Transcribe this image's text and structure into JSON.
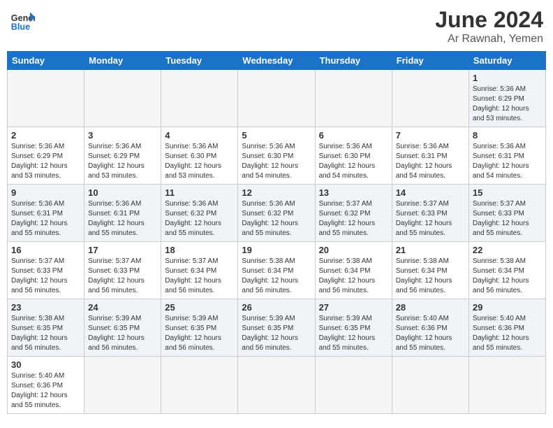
{
  "header": {
    "logo_general": "General",
    "logo_blue": "Blue",
    "title": "June 2024",
    "subtitle": "Ar Rawnah, Yemen"
  },
  "days_of_week": [
    "Sunday",
    "Monday",
    "Tuesday",
    "Wednesday",
    "Thursday",
    "Friday",
    "Saturday"
  ],
  "weeks": [
    [
      null,
      null,
      null,
      null,
      null,
      null,
      {
        "day": "1",
        "sunrise": "5:36 AM",
        "sunset": "6:29 PM",
        "daylight": "12 hours and 53 minutes."
      }
    ],
    [
      {
        "day": "2",
        "sunrise": "5:36 AM",
        "sunset": "6:29 PM",
        "daylight": "12 hours and 53 minutes."
      },
      {
        "day": "3",
        "sunrise": "5:36 AM",
        "sunset": "6:29 PM",
        "daylight": "12 hours and 53 minutes."
      },
      {
        "day": "4",
        "sunrise": "5:36 AM",
        "sunset": "6:30 PM",
        "daylight": "12 hours and 53 minutes."
      },
      {
        "day": "5",
        "sunrise": "5:36 AM",
        "sunset": "6:30 PM",
        "daylight": "12 hours and 54 minutes."
      },
      {
        "day": "6",
        "sunrise": "5:36 AM",
        "sunset": "6:30 PM",
        "daylight": "12 hours and 54 minutes."
      },
      {
        "day": "7",
        "sunrise": "5:36 AM",
        "sunset": "6:31 PM",
        "daylight": "12 hours and 54 minutes."
      },
      {
        "day": "8",
        "sunrise": "5:36 AM",
        "sunset": "6:31 PM",
        "daylight": "12 hours and 54 minutes."
      }
    ],
    [
      {
        "day": "9",
        "sunrise": "5:36 AM",
        "sunset": "6:31 PM",
        "daylight": "12 hours and 55 minutes."
      },
      {
        "day": "10",
        "sunrise": "5:36 AM",
        "sunset": "6:31 PM",
        "daylight": "12 hours and 55 minutes."
      },
      {
        "day": "11",
        "sunrise": "5:36 AM",
        "sunset": "6:32 PM",
        "daylight": "12 hours and 55 minutes."
      },
      {
        "day": "12",
        "sunrise": "5:36 AM",
        "sunset": "6:32 PM",
        "daylight": "12 hours and 55 minutes."
      },
      {
        "day": "13",
        "sunrise": "5:37 AM",
        "sunset": "6:32 PM",
        "daylight": "12 hours and 55 minutes."
      },
      {
        "day": "14",
        "sunrise": "5:37 AM",
        "sunset": "6:33 PM",
        "daylight": "12 hours and 55 minutes."
      },
      {
        "day": "15",
        "sunrise": "5:37 AM",
        "sunset": "6:33 PM",
        "daylight": "12 hours and 55 minutes."
      }
    ],
    [
      {
        "day": "16",
        "sunrise": "5:37 AM",
        "sunset": "6:33 PM",
        "daylight": "12 hours and 56 minutes."
      },
      {
        "day": "17",
        "sunrise": "5:37 AM",
        "sunset": "6:33 PM",
        "daylight": "12 hours and 56 minutes."
      },
      {
        "day": "18",
        "sunrise": "5:37 AM",
        "sunset": "6:34 PM",
        "daylight": "12 hours and 56 minutes."
      },
      {
        "day": "19",
        "sunrise": "5:38 AM",
        "sunset": "6:34 PM",
        "daylight": "12 hours and 56 minutes."
      },
      {
        "day": "20",
        "sunrise": "5:38 AM",
        "sunset": "6:34 PM",
        "daylight": "12 hours and 56 minutes."
      },
      {
        "day": "21",
        "sunrise": "5:38 AM",
        "sunset": "6:34 PM",
        "daylight": "12 hours and 56 minutes."
      },
      {
        "day": "22",
        "sunrise": "5:38 AM",
        "sunset": "6:34 PM",
        "daylight": "12 hours and 56 minutes."
      }
    ],
    [
      {
        "day": "23",
        "sunrise": "5:38 AM",
        "sunset": "6:35 PM",
        "daylight": "12 hours and 56 minutes."
      },
      {
        "day": "24",
        "sunrise": "5:39 AM",
        "sunset": "6:35 PM",
        "daylight": "12 hours and 56 minutes."
      },
      {
        "day": "25",
        "sunrise": "5:39 AM",
        "sunset": "6:35 PM",
        "daylight": "12 hours and 56 minutes."
      },
      {
        "day": "26",
        "sunrise": "5:39 AM",
        "sunset": "6:35 PM",
        "daylight": "12 hours and 56 minutes."
      },
      {
        "day": "27",
        "sunrise": "5:39 AM",
        "sunset": "6:35 PM",
        "daylight": "12 hours and 55 minutes."
      },
      {
        "day": "28",
        "sunrise": "5:40 AM",
        "sunset": "6:36 PM",
        "daylight": "12 hours and 55 minutes."
      },
      {
        "day": "29",
        "sunrise": "5:40 AM",
        "sunset": "6:36 PM",
        "daylight": "12 hours and 55 minutes."
      }
    ],
    [
      {
        "day": "30",
        "sunrise": "5:40 AM",
        "sunset": "6:36 PM",
        "daylight": "12 hours and 55 minutes."
      },
      null,
      null,
      null,
      null,
      null,
      null
    ]
  ]
}
